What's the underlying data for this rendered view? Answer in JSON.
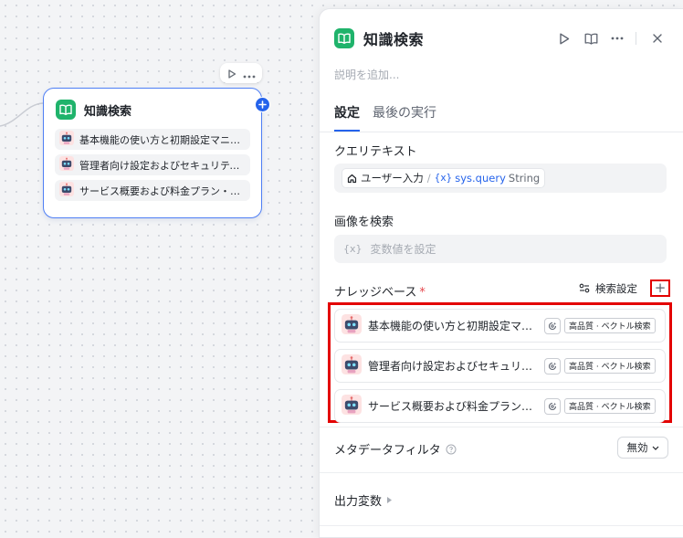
{
  "node": {
    "title": "知識検索",
    "items": [
      "基本機能の使い方と初期設定マニュ...",
      "管理者向け設定およびセキュリティポ...",
      "サービス概要および料金プラン・契約ガ..."
    ]
  },
  "panel": {
    "title": "知識検索",
    "description_placeholder": "説明を追加...",
    "tabs": [
      "設定",
      "最後の実行"
    ],
    "query": {
      "label": "クエリテキスト",
      "source": "ユーザー入力",
      "variable": "sys.query",
      "type": "String"
    },
    "image": {
      "label": "画像を検索",
      "placeholder": "変数値を設定"
    },
    "knowledge": {
      "label": "ナレッジベース",
      "required_mark": "*",
      "search_settings": "検索設定",
      "add": "+",
      "items": [
        {
          "name": "基本機能の使い方と初期設定マニ...",
          "mode": "高品質 · ベクトル検索"
        },
        {
          "name": "管理者向け設定およびセキュリティ...",
          "mode": "高品質 · ベクトル検索"
        },
        {
          "name": "サービス概要および料金プラン・契...",
          "mode": "高品質 · ベクトル検索"
        }
      ]
    },
    "metadata": {
      "label": "メタデータフィルタ",
      "value": "無効"
    },
    "output": {
      "label": "出力変数"
    }
  },
  "colors": {
    "accent": "#2563eb",
    "highlight": "#e30000",
    "kb_green": "#1fb36b"
  }
}
